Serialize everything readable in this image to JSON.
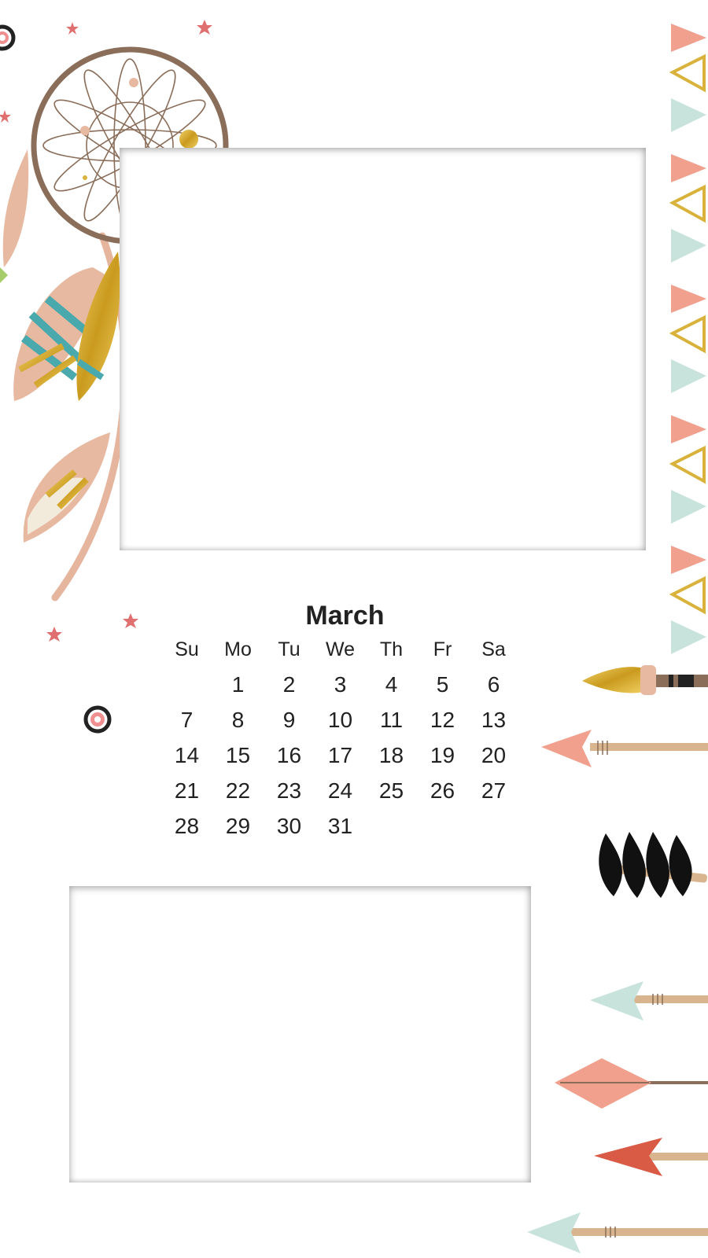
{
  "calendar": {
    "month": "March",
    "weekdays": [
      "Su",
      "Mo",
      "Tu",
      "We",
      "Th",
      "Fr",
      "Sa"
    ],
    "weeks": [
      [
        "",
        "1",
        "2",
        "3",
        "4",
        "5",
        "6"
      ],
      [
        "7",
        "8",
        "9",
        "10",
        "11",
        "12",
        "13"
      ],
      [
        "14",
        "15",
        "16",
        "17",
        "18",
        "19",
        "20"
      ],
      [
        "21",
        "22",
        "23",
        "24",
        "25",
        "26",
        "27"
      ],
      [
        "28",
        "29",
        "30",
        "31",
        "",
        "",
        ""
      ]
    ]
  },
  "decorations": {
    "top_left": "dreamcatcher-icon",
    "right_column": "triangle-bunting",
    "arrows": [
      "brush-arrow-icon",
      "arrow-icon",
      "feather-arrow-icon",
      "arrow-icon",
      "arrow-icon",
      "arrow-icon",
      "arrow-icon"
    ],
    "stars": "star-icon"
  },
  "colors": {
    "salmon": "#f2a08e",
    "mint": "#c7e3dc",
    "gold": "#d8b23a",
    "brown": "#8a6e5a",
    "teal": "#4aa9ad",
    "star": "#e07070",
    "text": "#222222"
  }
}
